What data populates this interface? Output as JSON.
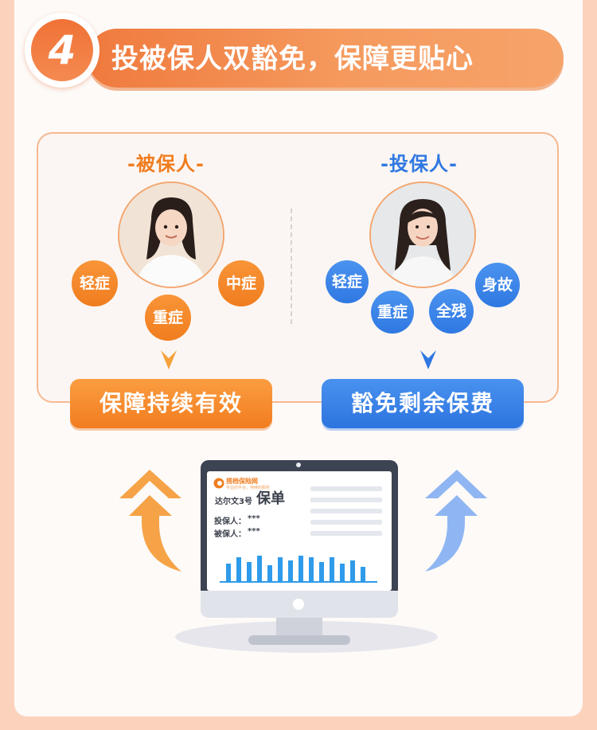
{
  "header": {
    "step_number": "4",
    "title": "投被保人双豁免，保障更贴心"
  },
  "insured": {
    "title": "-被保人-",
    "tags": [
      "轻症",
      "中症",
      "重症"
    ],
    "result": "保障持续有效",
    "color": "#f07d1f"
  },
  "policyholder": {
    "title": "-投保人-",
    "tags": [
      "轻症",
      "身故",
      "重症",
      "全残"
    ],
    "result": "豁免剩余保费",
    "color": "#2f78e2"
  },
  "monitor": {
    "logo_text": "搭档保险网",
    "logo_sub": "专业的平台，持续的服务",
    "product": "达尔文3号",
    "doc_title": "保单",
    "holder_label": "投保人：",
    "holder_value": "***",
    "insured_label": "被保人：",
    "insured_value": "***",
    "bars": [
      22,
      30,
      24,
      32,
      20,
      30,
      26,
      32,
      30,
      24,
      30,
      22,
      26,
      18
    ]
  }
}
